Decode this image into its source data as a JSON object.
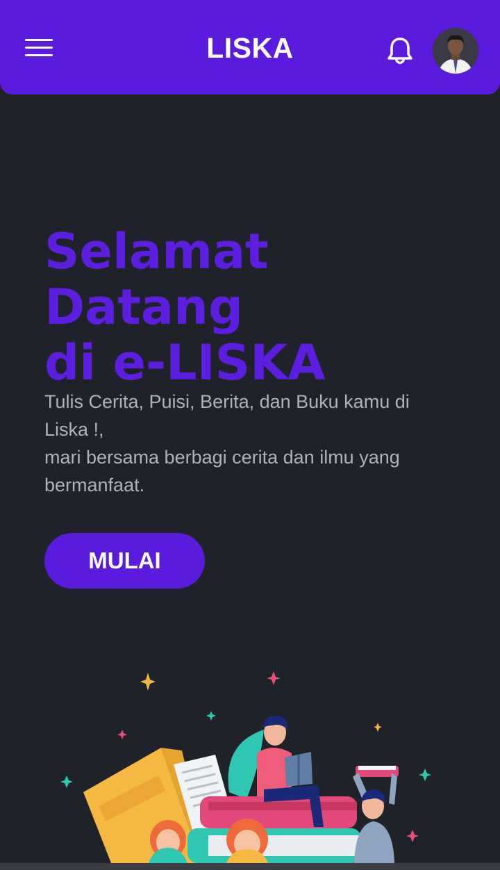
{
  "header": {
    "title": "LISKA",
    "menu_icon": "hamburger-menu-icon",
    "notification_icon": "bell-icon",
    "avatar": "user-avatar"
  },
  "hero": {
    "title_lines": [
      "Selamat",
      "Datang",
      "di e-LISKA"
    ],
    "description_lines": [
      "Tulis Cerita, Puisi, Berita, dan Buku kamu di",
      "Liska !,",
      "mari bersama berbagi cerita dan ilmu yang",
      "bermanfaat."
    ],
    "cta_label": "MULAI"
  },
  "illustration": {
    "name": "people-reading-books-illustration"
  },
  "colors": {
    "primary": "#5b1bdc",
    "background": "#1f2229",
    "text_muted": "#aeb2bc"
  }
}
